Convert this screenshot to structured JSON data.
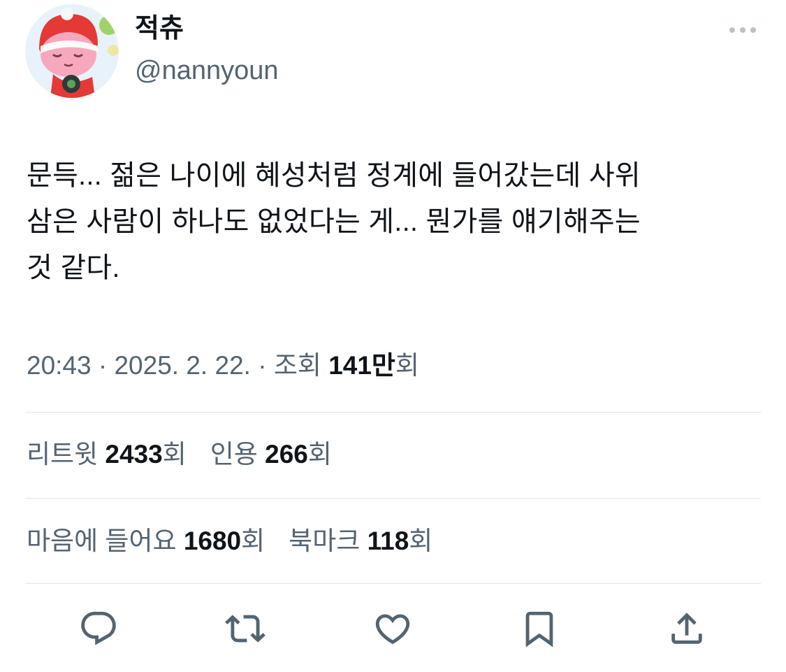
{
  "author": {
    "display_name": "적츄",
    "handle": "@nannyoun"
  },
  "tweet": {
    "text": "문득... 젊은 나이에 혜성처럼 정계에 들어갔는데 사위\n삼은 사람이 하나도 없었다는 게... 뭔가를 얘기해주는\n것 같다."
  },
  "meta": {
    "time": "20:43",
    "sep1": " · ",
    "date": "2025. 2. 22.",
    "sep2": " · ",
    "views_label": "조회 ",
    "views_count": "141만",
    "views_suffix": "회"
  },
  "stats": {
    "retweets_label": "리트윗 ",
    "retweets_count": "2433",
    "retweets_suffix": "회",
    "quotes_label": "인용 ",
    "quotes_count": "266",
    "quotes_suffix": "회",
    "likes_label": "마음에 들어요 ",
    "likes_count": "1680",
    "likes_suffix": "회",
    "bookmarks_label": "북마크 ",
    "bookmarks_count": "118",
    "bookmarks_suffix": "회"
  },
  "actions": {
    "reply_icon": "reply-icon",
    "retweet_icon": "retweet-icon",
    "like_icon": "heart-icon",
    "bookmark_icon": "bookmark-icon",
    "share_icon": "share-icon"
  },
  "colors": {
    "text_primary": "#0f1419",
    "text_secondary": "#536471",
    "divider": "#dfe3e6",
    "icon": "#536471"
  }
}
